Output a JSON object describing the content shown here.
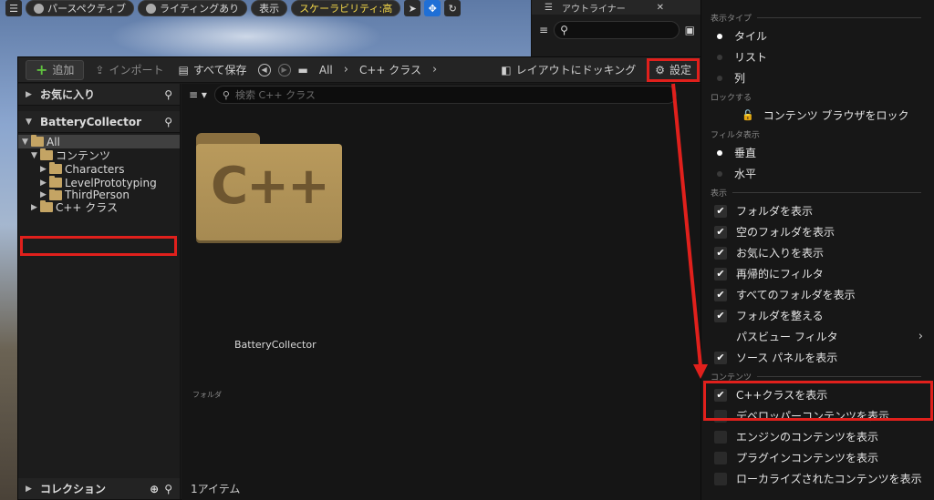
{
  "viewport": {
    "perspective": "パースペクティブ",
    "lighting": "ライティングあり",
    "show": "表示",
    "scalability": "スケーラビリティ:高"
  },
  "outliner": {
    "title": "アウトライナー"
  },
  "toolbar": {
    "add": "追加",
    "import": "インポート",
    "save_all": "すべて保存",
    "breadcrumb": [
      "All",
      "C++ クラス"
    ],
    "dock_layout": "レイアウトにドッキング",
    "settings": "設定"
  },
  "sidebar": {
    "favorites": "お気に入り",
    "project": "BatteryCollector",
    "tree": [
      {
        "label": "All",
        "depth": 0,
        "expanded": true
      },
      {
        "label": "コンテンツ",
        "depth": 1,
        "expanded": true
      },
      {
        "label": "Characters",
        "depth": 2
      },
      {
        "label": "LevelPrototyping",
        "depth": 2
      },
      {
        "label": "ThirdPerson",
        "depth": 2
      },
      {
        "label": "C++ クラス",
        "depth": 1,
        "selected": true
      }
    ],
    "collections": "コレクション"
  },
  "main": {
    "search_placeholder": "検索 C++ クラス",
    "tile_glyph": "C++",
    "tile_name": "BatteryCollector",
    "tile_type": "フォルダ",
    "item_count": "1アイテム"
  },
  "menu": {
    "sections": {
      "view_type": "表示タイプ",
      "lock": "ロックする",
      "filter_view": "フィルタ表示",
      "display": "表示",
      "content": "コンテンツ"
    },
    "view_type": [
      {
        "label": "タイル",
        "selected": true
      },
      {
        "label": "リスト",
        "selected": false
      },
      {
        "label": "列",
        "selected": false
      }
    ],
    "lock_item": "コンテンツ ブラウザをロック",
    "filter_view": [
      {
        "label": "垂直",
        "selected": true
      },
      {
        "label": "水平",
        "selected": false
      }
    ],
    "display": [
      {
        "label": "フォルダを表示",
        "checked": true
      },
      {
        "label": "空のフォルダを表示",
        "checked": true
      },
      {
        "label": "お気に入りを表示",
        "checked": true
      },
      {
        "label": "再帰的にフィルタ",
        "checked": true
      },
      {
        "label": "すべてのフォルダを表示",
        "checked": true
      },
      {
        "label": "フォルダを整える",
        "checked": true
      },
      {
        "label": "パスビュー フィルタ",
        "submenu": true
      },
      {
        "label": "ソース パネルを表示",
        "checked": true
      }
    ],
    "content": [
      {
        "label": "C++クラスを表示",
        "checked": true
      },
      {
        "label": "デベロッパーコンテンツを表示",
        "checked": false
      },
      {
        "label": "エンジンのコンテンツを表示",
        "checked": false
      },
      {
        "label": "プラグインコンテンツを表示",
        "checked": false
      },
      {
        "label": "ローカライズされたコンテンツを表示",
        "checked": false
      }
    ]
  },
  "colors": {
    "annotation": "#e0201c",
    "folder": "#c4a464",
    "accent": "#1f6fd6"
  }
}
